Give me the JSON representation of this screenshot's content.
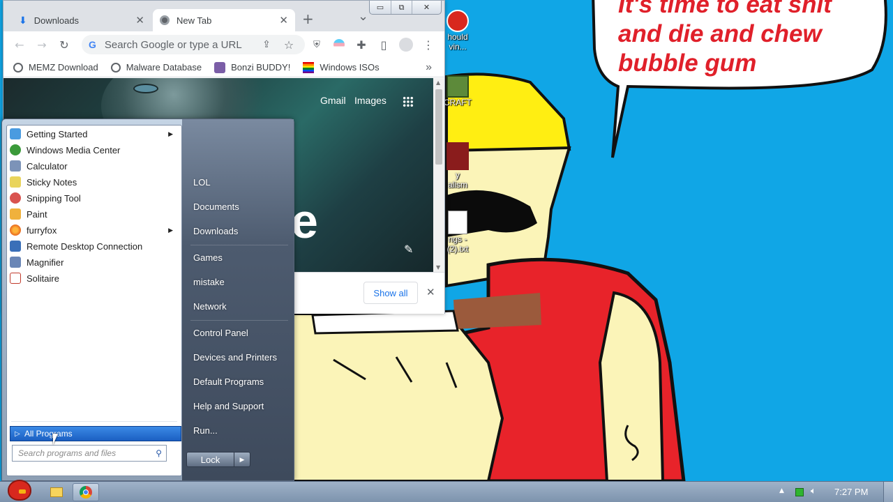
{
  "desktop": {
    "speech_bubble_lines": [
      "It's time to eat shit",
      "and die and chew",
      "bubble gum"
    ],
    "icons": [
      {
        "name": "angry-birds-icon",
        "label": "hould\nvin..."
      },
      {
        "name": "minecraft-icon",
        "label": "CRAFT"
      },
      {
        "name": "vandalism-icon",
        "label": "y\nalism"
      },
      {
        "name": "txt-file-icon",
        "label": "ngs -\n(2).txt"
      }
    ],
    "colors": {
      "sky": "#10a6e6",
      "shirt": "#e8232a",
      "skin": "#fbf4b8",
      "hat": "#ffee12"
    }
  },
  "browser": {
    "tabs": [
      {
        "label": "Downloads",
        "icon": "download-icon",
        "active": false
      },
      {
        "label": "New Tab",
        "icon": "chrome-icon",
        "active": true
      }
    ],
    "new_tab_symbol": "+",
    "tab_search_symbol": "⌄",
    "window_controls": {
      "minimize": "▭",
      "restore": "⧉",
      "close": "✕"
    },
    "omnibox_placeholder": "Search Google or type a URL",
    "bookmarks": [
      {
        "label": "MEMZ Download",
        "icon": "globe-icon"
      },
      {
        "label": "Malware Database",
        "icon": "globe-icon"
      },
      {
        "label": "Bonzi BUDDY!",
        "icon": "bonzi-icon"
      },
      {
        "label": "Windows ISOs",
        "icon": "rainbow-flag-icon"
      }
    ],
    "bookmarks_overflow": "»",
    "page_links": {
      "gmail": "Gmail",
      "images": "Images"
    },
    "page_partial_text": "e",
    "downloads_bar": {
      "show_all": "Show all",
      "close": "✕"
    }
  },
  "start_menu": {
    "programs": [
      {
        "label": "Getting Started",
        "icon": "getting-started-icon",
        "color": "#4a9be0",
        "submenu": true
      },
      {
        "label": "Windows Media Center",
        "icon": "media-center-icon",
        "color": "#3b9a3a",
        "submenu": false
      },
      {
        "label": "Calculator",
        "icon": "calculator-icon",
        "color": "#7c93b8",
        "submenu": false
      },
      {
        "label": "Sticky Notes",
        "icon": "sticky-notes-icon",
        "color": "#e9d45c",
        "submenu": false
      },
      {
        "label": "Snipping Tool",
        "icon": "snipping-tool-icon",
        "color": "#d9534f",
        "submenu": false
      },
      {
        "label": "Paint",
        "icon": "paint-icon",
        "color": "#f0b13c",
        "submenu": false
      },
      {
        "label": "furryfox",
        "icon": "firefox-icon",
        "color": "#e8681e",
        "submenu": true
      },
      {
        "label": "Remote Desktop Connection",
        "icon": "remote-desktop-icon",
        "color": "#3a6fb8",
        "submenu": false
      },
      {
        "label": "Magnifier",
        "icon": "magnifier-icon",
        "color": "#6a86b6",
        "submenu": false
      },
      {
        "label": "Solitaire",
        "icon": "solitaire-icon",
        "color": "#c0392b",
        "submenu": false
      }
    ],
    "all_programs": "All Programs",
    "search_placeholder": "Search programs and files",
    "places": [
      "LOL",
      "Documents",
      "Downloads",
      "Games",
      "mistake",
      "Network",
      "Control Panel",
      "Devices and Printers",
      "Default Programs",
      "Help and Support",
      "Run..."
    ],
    "lock_label": "Lock"
  },
  "taskbar": {
    "items": [
      "start-orb-angry-bird",
      "explorer",
      "chrome"
    ],
    "tray_up": "▲",
    "clock": "7:27 PM"
  }
}
